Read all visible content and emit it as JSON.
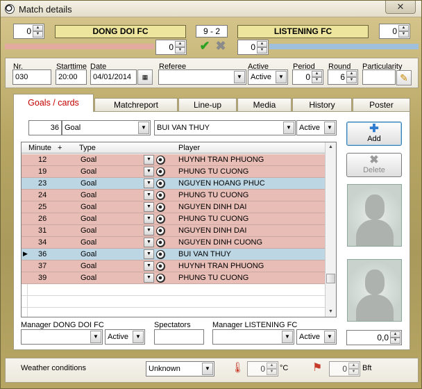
{
  "window": {
    "title": "Match details",
    "close_glyph": "✕"
  },
  "header": {
    "home_team": "DONG DOI FC",
    "away_team": "LISTENING FC",
    "home_score": "0",
    "away_score": "0",
    "result": "9 - 2",
    "home_sub_score": "0",
    "away_sub_score": "0",
    "home_color": "#e3aaa0",
    "away_color": "#9fc0dd"
  },
  "info": {
    "nr_label": "Nr.",
    "nr_value": "030",
    "starttime_label": "Starttime",
    "starttime_value": "20:00",
    "date_label": "Date",
    "date_value": "04/01/2014",
    "referee_label": "Referee",
    "referee_value": "",
    "active_label": "Active",
    "active_value": "Active",
    "period_label": "Period",
    "period_value": "0",
    "round_label": "Round",
    "round_value": "6",
    "particularity_label": "Particularity",
    "particularity_value": ""
  },
  "tabs": [
    "Goals / cards",
    "Matchreport",
    "Line-up",
    "Media",
    "History",
    "Poster"
  ],
  "entry": {
    "minute": "36",
    "type": "Goal",
    "player": "BUI VAN THUY",
    "status": "Active"
  },
  "buttons": {
    "add": "Add",
    "delete": "Delete"
  },
  "grid": {
    "headers": {
      "minute": "Minute",
      "plus": "+",
      "type": "Type",
      "player": "Player"
    },
    "rows": [
      {
        "minute": "12",
        "type": "Goal",
        "player": "HUYNH TRAN PHUONG",
        "side": "home"
      },
      {
        "minute": "19",
        "type": "Goal",
        "player": "PHUNG TU CUONG",
        "side": "home"
      },
      {
        "minute": "23",
        "type": "Goal",
        "player": "NGUYEN HOANG PHUC",
        "side": "away"
      },
      {
        "minute": "24",
        "type": "Goal",
        "player": "PHUNG TU CUONG",
        "side": "home"
      },
      {
        "minute": "25",
        "type": "Goal",
        "player": "NGUYEN DINH DAI",
        "side": "home"
      },
      {
        "minute": "26",
        "type": "Goal",
        "player": "PHUNG TU CUONG",
        "side": "home"
      },
      {
        "minute": "31",
        "type": "Goal",
        "player": "NGUYEN DINH DAI",
        "side": "home"
      },
      {
        "minute": "34",
        "type": "Goal",
        "player": "NGUYEN DINH CUONG",
        "side": "home"
      },
      {
        "minute": "36",
        "type": "Goal",
        "player": "BUI VAN THUY",
        "side": "away",
        "current": true
      },
      {
        "minute": "37",
        "type": "Goal",
        "player": "HUYNH TRAN PHUONG",
        "side": "home"
      },
      {
        "minute": "39",
        "type": "Goal",
        "player": "PHUNG TU CUONG",
        "side": "home"
      }
    ],
    "home_row_color": "#e8bdb5",
    "away_row_color": "#bcd6e4"
  },
  "managers": {
    "home_label": "Manager DONG DOI FC",
    "home_value": "",
    "home_status": "Active",
    "spectators_label": "Spectators",
    "spectators_value": "",
    "away_label": "Manager LISTENING FC",
    "away_value": "",
    "away_status": "Active",
    "rating_value": "0,0"
  },
  "weather": {
    "label": "Weather conditions",
    "value": "Unknown",
    "temperature": "0",
    "temp_unit": "°C",
    "wind": "0",
    "wind_unit": "Bft"
  }
}
